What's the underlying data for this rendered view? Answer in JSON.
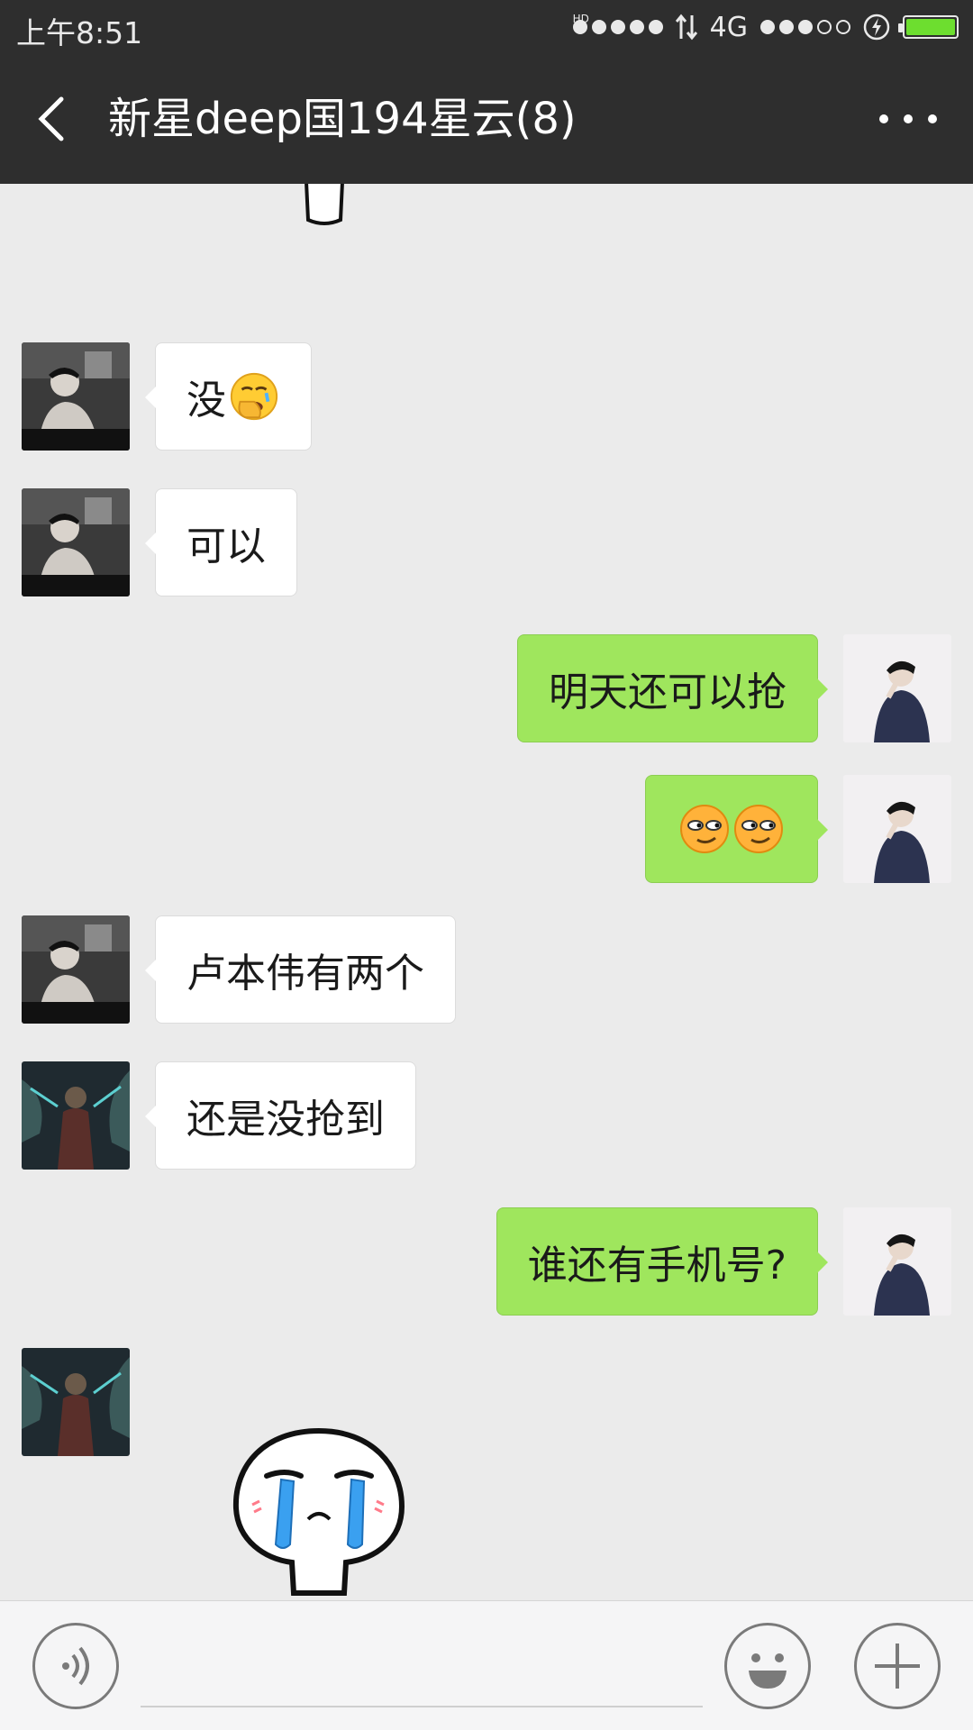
{
  "status_bar": {
    "time": "上午8:51",
    "network": "4G",
    "hd_label": "HD",
    "battery_level": 1.0,
    "signal_bars": 3
  },
  "header": {
    "title": "新星deep国194星云(8)"
  },
  "messages": [
    {
      "side": "left",
      "sender": "friend-a",
      "text": "没",
      "emoji": "facepalm-emoji"
    },
    {
      "side": "left",
      "sender": "friend-a",
      "text": "可以"
    },
    {
      "side": "right",
      "sender": "me",
      "text": "明天还可以抢"
    },
    {
      "side": "right",
      "sender": "me",
      "text": "",
      "emoji": "smirk-emoji-x2"
    },
    {
      "side": "left",
      "sender": "friend-a",
      "text": "卢本伟有两个"
    },
    {
      "side": "left",
      "sender": "friend-b",
      "text": "还是没抢到"
    },
    {
      "side": "right",
      "sender": "me",
      "text": "谁还有手机号?"
    },
    {
      "side": "left",
      "sender": "friend-b",
      "text": "",
      "sticker": "crying-sticker"
    }
  ],
  "input_bar": {
    "voice_icon": "voice-icon",
    "emoji_icon": "emoji-icon",
    "plus_icon": "plus-icon"
  },
  "colors": {
    "header_bg": "#2e2e2e",
    "chat_bg": "#ebebeb",
    "my_bubble": "#9fe65d",
    "their_bubble": "#ffffff",
    "battery_fill": "#6dde2f"
  }
}
